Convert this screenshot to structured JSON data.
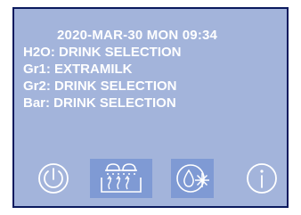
{
  "header": {
    "datetime": "2020-MAR-30 MON 09:34"
  },
  "status": {
    "h2o": "H2O: DRINK SELECTION",
    "gr1": "Gr1: EXTRAMILK",
    "gr2": "Gr2: DRINK SELECTION",
    "bar": "Bar: DRINK SELECTION"
  },
  "toolbar": {
    "icons": [
      "power-icon",
      "grinder-heating-icon",
      "water-cleaning-icon",
      "info-icon"
    ]
  },
  "colors": {
    "screen_background": "#a3b4db",
    "screen_border": "#0a1a5e",
    "text": "#ffffff",
    "button_highlight": "#7f9ad4"
  }
}
